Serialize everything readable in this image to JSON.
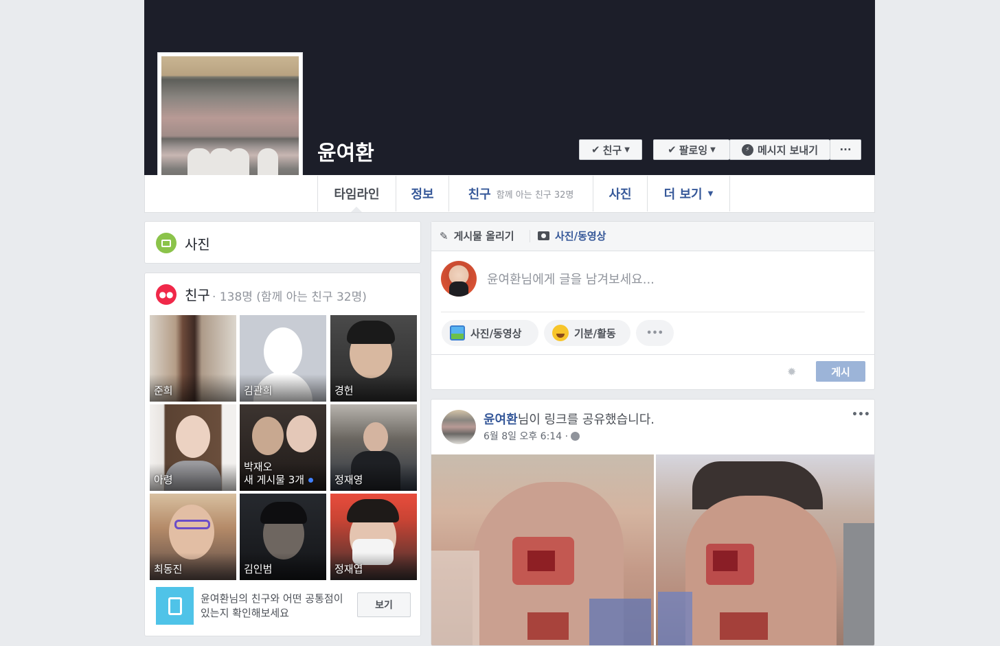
{
  "profile": {
    "name": "윤여환",
    "buttons": {
      "friend": "친구",
      "following": "팔로잉",
      "message": "메시지 보내기",
      "more": "···"
    }
  },
  "tabs": {
    "timeline": "타임라인",
    "about": "정보",
    "friends": "친구",
    "friends_sub": "함께 아는 친구 32명",
    "photos": "사진",
    "more": "더 보기"
  },
  "left": {
    "photos_title": "사진",
    "friends_title": "친구",
    "friends_count": "· 138명 (함께 아는 친구 32명)",
    "friends": [
      {
        "name": "준희"
      },
      {
        "name": "김관희"
      },
      {
        "name": "경헌"
      },
      {
        "name": "아령"
      },
      {
        "name": "박재오",
        "sub": "새 게시물 3개"
      },
      {
        "name": "정재영"
      },
      {
        "name": "최동진"
      },
      {
        "name": "김인범"
      },
      {
        "name": "정재엽"
      }
    ],
    "common_text": "윤여환님의 친구와 어떤 공통점이 있는지 확인해보세요",
    "common_button": "보기"
  },
  "composer": {
    "tab_post": "게시물 올리기",
    "tab_photo": "사진/동영상",
    "placeholder": "윤여환님에게 글을 남겨보세요...",
    "chip_photo": "사진/동영상",
    "chip_feeling": "기분/활동",
    "chip_more": "•••",
    "post_button": "게시"
  },
  "post": {
    "author": "윤여환",
    "action": "님이 링크를 공유했습니다.",
    "time": "6월 8일 오후 6:14 ·",
    "menu": "•••"
  },
  "colors": {
    "accent": "#365899",
    "cover": "#1c1e29",
    "post_button": "#9cb4d8",
    "photos_icon": "#8bc34a",
    "friends_icon": "#f02849"
  }
}
